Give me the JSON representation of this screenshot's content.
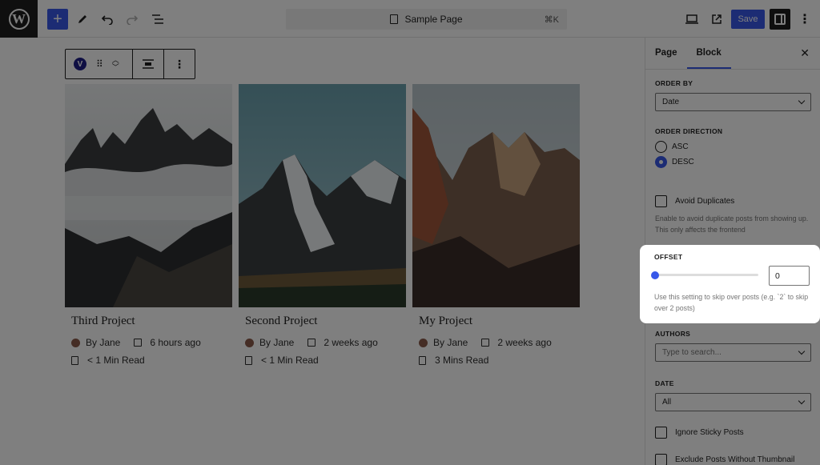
{
  "topbar": {
    "command_bar_title": "Sample Page",
    "command_shortcut": "⌘K",
    "save_label": "Save"
  },
  "cards": [
    {
      "title": "Third Project",
      "author": "By Jane",
      "date": "6 hours ago",
      "read_time": "< 1 Min Read"
    },
    {
      "title": "Second Project",
      "author": "By Jane",
      "date": "2 weeks ago",
      "read_time": "< 1 Min Read"
    },
    {
      "title": "My Project",
      "author": "By Jane",
      "date": "2 weeks ago",
      "read_time": "3 Mins Read"
    }
  ],
  "block_toolbar": {
    "badge": "V"
  },
  "sidebar": {
    "tabs": [
      "Page",
      "Block"
    ],
    "order_by": {
      "label": "ORDER BY",
      "value": "Date"
    },
    "order_direction": {
      "label": "ORDER DIRECTION",
      "options": [
        "ASC",
        "DESC"
      ],
      "selected": "DESC"
    },
    "avoid_duplicates": {
      "label": "Avoid Duplicates",
      "help": "Enable to avoid duplicate posts from showing up. This only affects the frontend"
    },
    "offset": {
      "label": "OFFSET",
      "value": "0",
      "help": "Use this setting to skip over posts (e.g. `2` to skip over 2 posts)"
    },
    "authors": {
      "label": "AUTHORS",
      "placeholder": "Type to search..."
    },
    "date": {
      "label": "DATE",
      "value": "All"
    },
    "ignore_sticky": {
      "label": "Ignore Sticky Posts"
    },
    "exclude_no_thumb": {
      "label": "Exclude Posts Without Thumbnail"
    }
  },
  "colors": {
    "accent": "#3858e9",
    "dark": "#1e1e1e"
  }
}
